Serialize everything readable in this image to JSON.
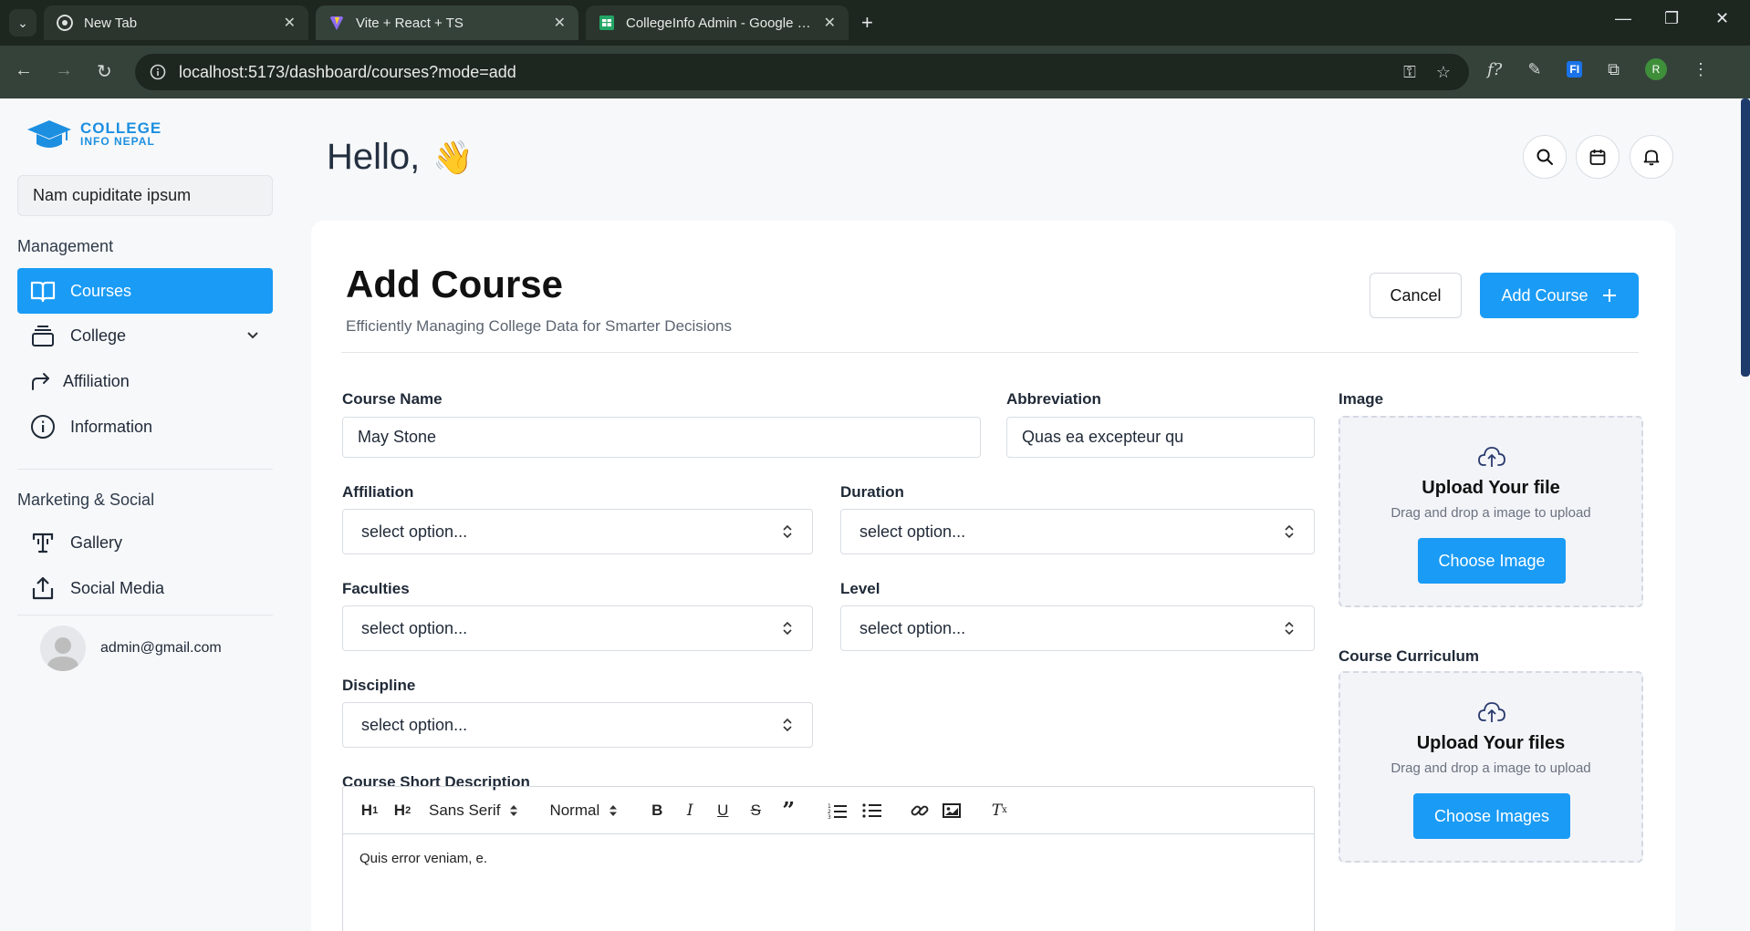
{
  "browser": {
    "tabs": [
      {
        "title": "New Tab"
      },
      {
        "title": "Vite + React + TS"
      },
      {
        "title": "CollegeInfo Admin - Google Sheets"
      }
    ],
    "url": "localhost:5173/dashboard/courses?mode=add",
    "profile_initial": "R"
  },
  "sidebar": {
    "logo_line1": "COLLEGE",
    "logo_line2": "INFO NEPAL",
    "search_value": "Nam cupiditate ipsum",
    "management_title": "Management",
    "management_items": [
      {
        "label": "Courses",
        "icon": "book-open-icon"
      },
      {
        "label": "College",
        "icon": "layers-icon"
      },
      {
        "label": "Affiliation",
        "icon": "share-arrow-icon"
      },
      {
        "label": "Information",
        "icon": "info-icon"
      }
    ],
    "marketing_title": "Marketing & Social",
    "marketing_items": [
      {
        "label": "Gallery",
        "icon": "gallery-icon"
      },
      {
        "label": "Social Media",
        "icon": "upload-share-icon"
      }
    ],
    "user_email": "admin@gmail.com"
  },
  "header": {
    "greeting": "Hello,",
    "greeting_emoji": "👋"
  },
  "form": {
    "title": "Add Course",
    "subtitle": "Efficiently Managing College Data for Smarter Decisions",
    "cancel_label": "Cancel",
    "submit_label": "Add Course",
    "course_name": {
      "label": "Course Name",
      "value": "May Stone"
    },
    "abbreviation": {
      "label": "Abbreviation",
      "value": "Quas ea excepteur qu"
    },
    "affiliation": {
      "label": "Affiliation",
      "value": "select option..."
    },
    "duration": {
      "label": "Duration",
      "value": "select option..."
    },
    "faculties": {
      "label": "Faculties",
      "value": "select option..."
    },
    "level": {
      "label": "Level",
      "value": "select option..."
    },
    "discipline": {
      "label": "Discipline",
      "value": "select option..."
    },
    "short_description": {
      "label": "Course Short Description",
      "font_value": "Sans Serif",
      "size_value": "Normal",
      "body": "Quis error veniam, e."
    },
    "image": {
      "label": "Image",
      "title": "Upload Your file",
      "subtitle": "Drag and drop a image to upload",
      "button": "Choose Image"
    },
    "curriculum": {
      "label": "Course Curriculum",
      "title": "Upload Your files",
      "subtitle": "Drag and drop a image to upload",
      "button": "Choose Images"
    }
  },
  "colors": {
    "accent": "#1a9bf5",
    "browser_dark": "#1e2620",
    "browser_toolbar": "#34423a"
  }
}
